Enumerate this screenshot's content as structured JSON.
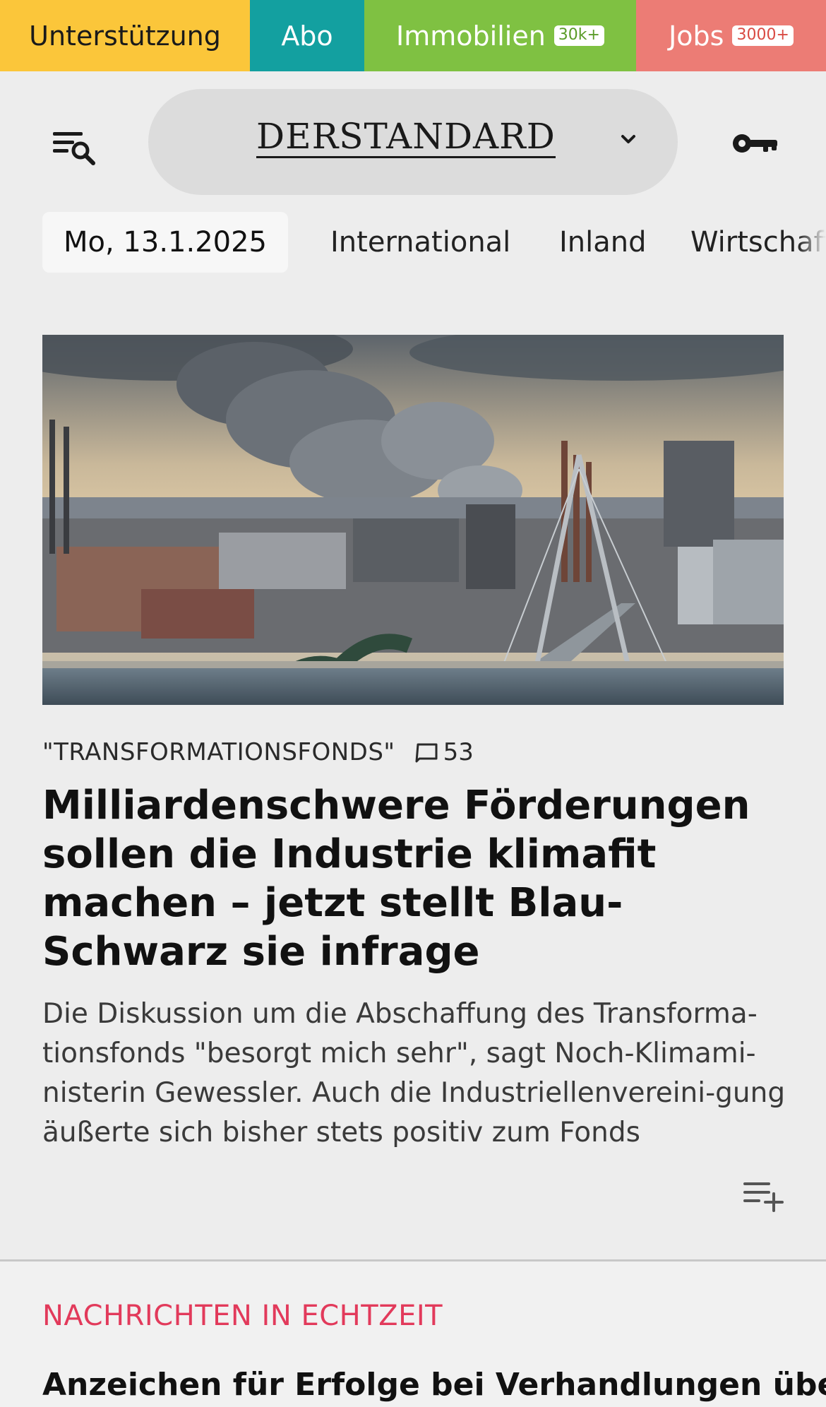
{
  "topbar": {
    "unterstuetzung": "Unterstützung",
    "abo": "Abo",
    "immobilien": "Immobilien",
    "immobilien_badge": "30k+",
    "jobs": "Jobs",
    "jobs_badge": "3000+"
  },
  "header": {
    "logo": "DERSTANDARD",
    "menu_icon": "menu-search-icon",
    "dropdown_icon": "chevron-down-icon",
    "login_icon": "key-icon"
  },
  "nav": {
    "date": "Mo, 13.1.2025",
    "items": [
      "International",
      "Inland",
      "Wirtschaft"
    ]
  },
  "lead": {
    "kicker": "\"TRANSFORMATIONSFONDS\"",
    "comment_count": "53",
    "headline": "Milliardenschwere Förderungen sollen die Industrie klimafit machen – jetzt stellt Blau-Schwarz sie infrage",
    "teaser": "Die Diskussion um die Abschaffung des Transforma-tionsfonds \"besorgt mich sehr\", sagt Noch-Klimami-nisterin Gewessler. Auch die Industriellenvereini-gung äußerte sich bisher stets positiv zum Fonds"
  },
  "live": {
    "section_title": "NACHRICHTEN IN ECHTZEIT",
    "headline": "Anzeichen für Erfolge bei Verhandlungen über"
  },
  "colors": {
    "unterstuetzung": "#fbc63a",
    "abo": "#13a0a0",
    "immobilien": "#7fc142",
    "jobs": "#ec7c75",
    "accent_red": "#e23a5b"
  }
}
